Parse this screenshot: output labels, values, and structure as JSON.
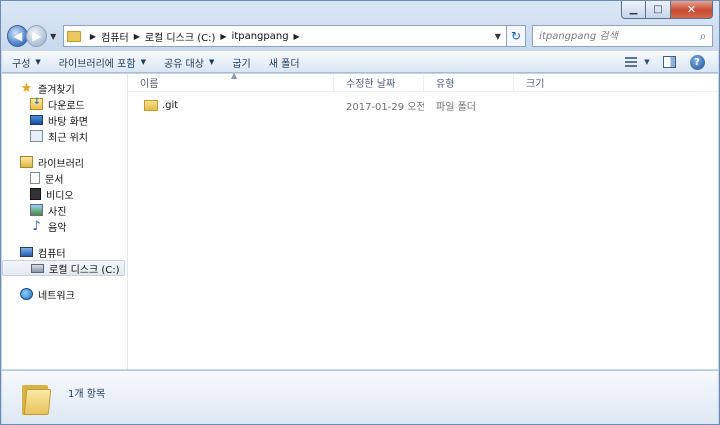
{
  "window": {
    "caption": {
      "minimize": "▁",
      "maximize": "□",
      "close": "✕"
    }
  },
  "address_bar": {
    "crumbs": [
      "컴퓨터",
      "로컬 디스크 (C:)",
      "itpangpang"
    ],
    "search_placeholder": "itpangpang 검색"
  },
  "toolbar": {
    "organize": "구성",
    "include_library": "라이브러리에 포함",
    "share_with": "공유 대상",
    "burn": "굽기",
    "new_folder": "새 폴더"
  },
  "nav_pane": {
    "favorites": {
      "label": "즐겨찾기",
      "items": [
        "다운로드",
        "바탕 화면",
        "최근 위치"
      ]
    },
    "libraries": {
      "label": "라이브러리",
      "items": [
        "문서",
        "비디오",
        "사진",
        "음악"
      ]
    },
    "computer": {
      "label": "컴퓨터",
      "items": [
        "로컬 디스크 (C:)"
      ]
    },
    "network": {
      "label": "네트워크"
    }
  },
  "columns": {
    "name": "이름",
    "date": "수정한 날짜",
    "type": "유형",
    "size": "크기"
  },
  "files": [
    {
      "name": ".git",
      "date": "2017-01-29 오전...",
      "type": "파일 폴더",
      "size": ""
    }
  ],
  "status": {
    "item_count": "1개 항목"
  },
  "colors": {
    "accent": "#1e395b",
    "window_frame": "#c4d6ec",
    "close_button": "#c84a32"
  }
}
